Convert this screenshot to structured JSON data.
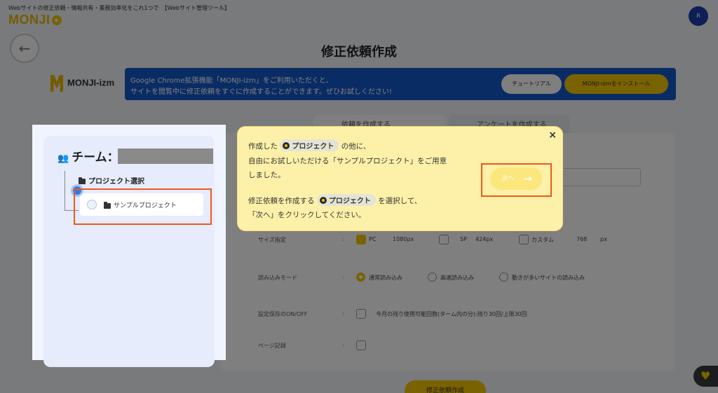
{
  "header": {
    "tagline": "Webサイトの修正依頼・情報共有・業務効率化をこれ1つで　【Webサイト管理ツール】",
    "logo_text": "MONJI",
    "avatar_initial": "R"
  },
  "page": {
    "back_icon": "←",
    "title": "修正依頼作成"
  },
  "banner": {
    "logo_text": "MONJI-izm",
    "line1": "Google Chrome拡張機能「MONJI-izm」をご利用いただくと、",
    "line2": "サイトを閲覧中に修正依頼をすぐに作成することができます。ぜひお試しください!",
    "tutorial_label": "チュートリアル",
    "install_label": "MONJI-izmをインストール"
  },
  "form": {
    "tab1": "依頼を作成する",
    "tab2": "アンケートを作成する",
    "rows": [
      {
        "label": "サイズ指定",
        "options": [
          "PC",
          "1080px",
          "SP",
          "424px",
          "カスタム",
          "768",
          "px"
        ]
      },
      {
        "label": "読み込みモード",
        "options": [
          "通常読み込み",
          "高速読み込み",
          "動きが多いサイトの読み込み"
        ]
      },
      {
        "label": "設定保存のON/OFF",
        "options": [
          "今月の残り使用可能回数(ターム内の分):残り30回/上限30回"
        ]
      },
      {
        "label": "ページ記録",
        "options": []
      }
    ],
    "submit_label": "修正依頼作成"
  },
  "team_panel": {
    "title": "チーム：",
    "project_select_label": "プロジェクト選択",
    "sample_project_label": "サンプルプロジェクト"
  },
  "tooltip": {
    "close_icon": "×",
    "line1_pre": "作成した",
    "project_pill": "プロジェクト",
    "line1_post": "の他に、",
    "line2": "自由にお試しいただける「サンプルプロジェクト」をご用意",
    "line3": "しました。",
    "line4_pre": "修正依頼を作成する",
    "line4_post": "を選択して、",
    "line5": "「次へ」をクリックしてください。",
    "next_label": "次へ",
    "next_arrow": "→"
  },
  "chat": {
    "icon": "♥"
  },
  "colors": {
    "accent": "#f2c500",
    "banner_blue": "#1459c9",
    "highlight_orange": "#f05a1a",
    "tooltip_bg": "#fdf0a8"
  }
}
